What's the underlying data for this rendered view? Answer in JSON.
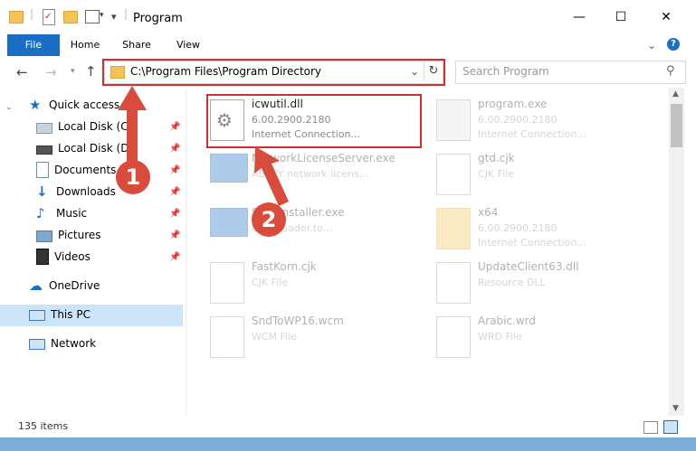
{
  "window": {
    "title": "Program",
    "minimize": "—",
    "maximize": "☐",
    "close": "✕"
  },
  "ribbon": {
    "tabs": [
      "File",
      "Home",
      "Share",
      "View"
    ]
  },
  "address": {
    "path": "C:\\Program Files\\Program Directory",
    "search_placeholder": "Search Program"
  },
  "sidebar": {
    "quick_access": "Quick access",
    "items": [
      {
        "label": "Local Disk (C:)",
        "icon": "drive-icon"
      },
      {
        "label": "Local Disk (D:)",
        "icon": "drive-icon"
      },
      {
        "label": "Documents",
        "icon": "documents-icon"
      },
      {
        "label": "Downloads",
        "icon": "downloads-icon"
      },
      {
        "label": "Music",
        "icon": "music-icon"
      },
      {
        "label": "Pictures",
        "icon": "pictures-icon"
      },
      {
        "label": "Videos",
        "icon": "videos-icon"
      }
    ],
    "onedrive": "OneDrive",
    "thispc": "This PC",
    "network": "Network"
  },
  "files": [
    {
      "name": "icwutil.dll",
      "line2": "6.00.2900.2180",
      "line3": "Internet Connection...",
      "highlighted": true
    },
    {
      "name": "program.exe",
      "line2": "6.00.2900.2180",
      "line3": "Internet Connection..."
    },
    {
      "name": "NetworkLicenseServer.exe",
      "line2": "ABBYY network licens..."
    },
    {
      "name": "gtd.cjk",
      "line2": "CJK File"
    },
    {
      "name": "SemiInstaller.exe",
      "line2": "Ofilewsader.to..."
    },
    {
      "name": "x64",
      "line2": "6.00.2900.2180",
      "line3": "Internet Connection..."
    },
    {
      "name": "FastKorn.cjk",
      "line2": "CJK File"
    },
    {
      "name": "UpdateClient63.dll",
      "line2": "Resource DLL"
    },
    {
      "name": "SndToWP16.wcm",
      "line2": "WCM File"
    },
    {
      "name": "Arabic.wrd",
      "line2": "WRD File"
    }
  ],
  "status": {
    "count": "135 items"
  },
  "markers": [
    "1",
    "2"
  ],
  "colors": {
    "accent": "#1a6fc4",
    "highlight_red": "#d32f2f",
    "marker_red": "#d94b3a",
    "selected_nav": "#cce4f7"
  }
}
